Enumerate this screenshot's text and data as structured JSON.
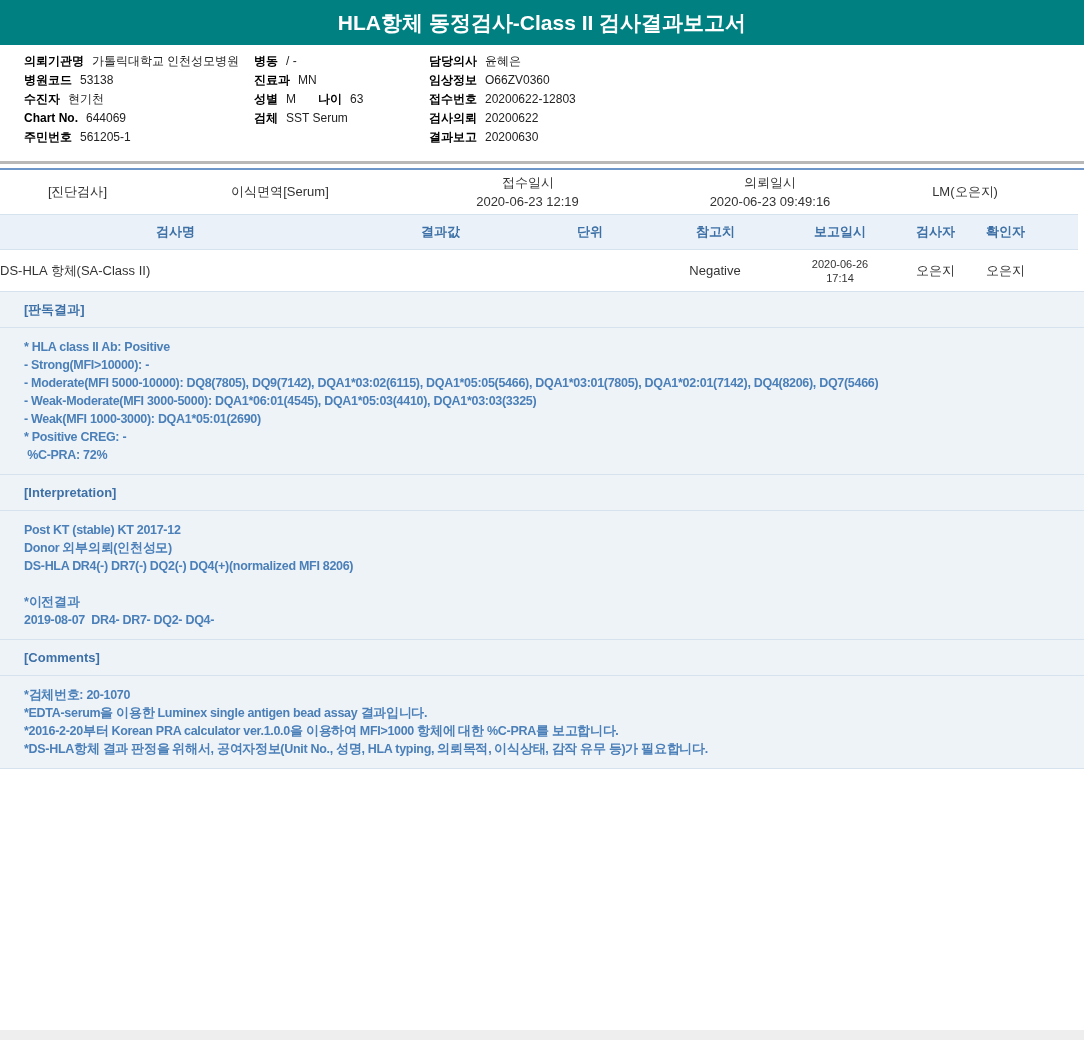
{
  "title": "HLA항체 동정검사-Class II 검사결과보고서",
  "patient_info": [
    [
      [
        {
          "label": "의뢰기관명",
          "value": "가톨릭대학교 인천성모병원"
        }
      ],
      [
        {
          "label": "병원코드",
          "value": "53138"
        }
      ],
      [
        {
          "label": "수진자",
          "value": "현기천"
        }
      ],
      [
        {
          "label": "Chart No.",
          "value": "644069"
        }
      ],
      [
        {
          "label": "주민번호",
          "value": "561205-1"
        }
      ]
    ],
    [
      [
        {
          "label": "병동",
          "value": "/ -"
        }
      ],
      [
        {
          "label": "진료과",
          "value": "MN"
        }
      ],
      [
        {
          "label": "성별",
          "value": "M"
        },
        {
          "label": "나이",
          "value": "63"
        }
      ],
      [
        {
          "label": "검체",
          "value": "SST Serum"
        }
      ]
    ],
    [
      [
        {
          "label": "담당의사",
          "value": "윤혜은"
        }
      ],
      [
        {
          "label": "임상정보",
          "value": "O66ZV0360"
        }
      ],
      [
        {
          "label": "접수번호",
          "value": "20200622-12803"
        }
      ],
      [
        {
          "label": "검사의뢰",
          "value": "20200622"
        }
      ],
      [
        {
          "label": "결과보고",
          "value": "20200630"
        }
      ]
    ]
  ],
  "order": {
    "category": "[진단검사]",
    "department": "이식면역[Serum]",
    "received_label": "접수일시",
    "received": "2020-06-23 12:19",
    "requested_label": "의뢰일시",
    "requested": "2020-06-23 09:49:16",
    "lab": "LM(오은지)"
  },
  "table": {
    "columns": [
      "검사명",
      "결과값",
      "단위",
      "참고치",
      "보고일시",
      "검사자",
      "확인자"
    ],
    "rows": [
      {
        "name": "DS-HLA 항체(SA-Class II)",
        "reference": "Negative",
        "report_date": "2020-06-26",
        "report_time": "17:14",
        "tester": "오은지",
        "confirmer": "오은지"
      }
    ]
  },
  "sections": [
    {
      "heading": "[판독결과]",
      "paragraphs": [
        [
          "* HLA class II Ab: Positive",
          "- Strong(MFI>10000): -",
          "- Moderate(MFI 5000-10000): DQ8(7805), DQ9(7142), DQA1*03:02(6115), DQA1*05:05(5466), DQA1*03:01(7805), DQA1*02:01(7142), DQ4(8206), DQ7(5466)",
          "- Weak-Moderate(MFI 3000-5000): DQA1*06:01(4545), DQA1*05:03(4410), DQA1*03:03(3325)",
          "- Weak(MFI 1000-3000): DQA1*05:01(2690)",
          "* Positive CREG: -",
          " %C-PRA: 72%"
        ]
      ]
    },
    {
      "heading": "[Interpretation]",
      "paragraphs": [
        [
          "Post KT (stable) KT 2017-12",
          "Donor 외부의뢰(인천성모)",
          "DS-HLA DR4(-) DR7(-) DQ2(-) DQ4(+)(normalized MFI 8206)"
        ],
        [
          "*이전결과",
          "2019-08-07  DR4- DR7- DQ2- DQ4-"
        ]
      ]
    },
    {
      "heading": "[Comments]",
      "paragraphs": [
        [
          "*검체번호: 20-1070",
          "*EDTA-serum을 이용한 Luminex single antigen bead assay 결과입니다.",
          "*2016-2-20부터 Korean PRA calculator ver.1.0.0을 이용하여 MFI>1000 항체에 대한 %C-PRA를 보고합니다.",
          "*DS-HLA항체 결과 판정을 위해서, 공여자정보(Unit No., 성명, HLA typing, 의뢰목적, 이식상태, 감작 유무 등)가 필요합니다."
        ]
      ]
    }
  ]
}
